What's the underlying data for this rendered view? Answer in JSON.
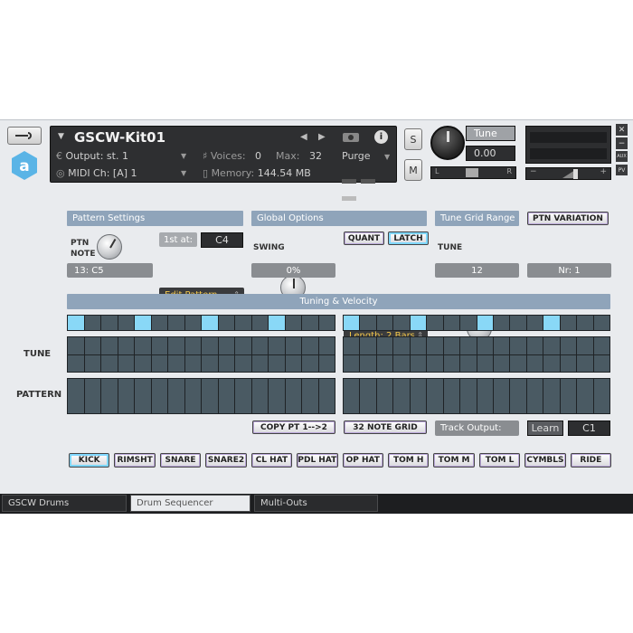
{
  "header": {
    "instrument_name": "GSCW-Kit01",
    "output_label": "Output:",
    "output_value": "st. 1",
    "midi_label": "MIDI Ch:",
    "midi_value": "[A] 1",
    "voices_label": "Voices:",
    "voices_value": "0",
    "max_label": "Max:",
    "max_value": "32",
    "memory_label": "Memory:",
    "memory_value": "144.54 MB",
    "purge_label": "Purge",
    "s_label": "S",
    "m_label": "M",
    "tune_label": "Tune",
    "tune_value": "0.00",
    "pan_left": "L",
    "pan_right": "R",
    "vol_minus": "−",
    "vol_plus": "+",
    "aux_label": "AUX",
    "pv_label": "PV"
  },
  "pattern_settings": {
    "title": "Pattern Settings",
    "ptn_note_label": "PTN\nNOTE",
    "first_at_label": "1st at:",
    "first_at_value": "C4",
    "note_value": "13: C5",
    "edit_pattern": "Edit Pattern..."
  },
  "global_options": {
    "title": "Global Options",
    "swing_label": "SWING",
    "swing_value": "0%",
    "quant": "QUANT",
    "latch": "LATCH",
    "length": "Length: 2 Bars"
  },
  "tune_grid": {
    "title": "Tune Grid Range",
    "tune_label": "TUNE",
    "tune_value": "12"
  },
  "ptn_variation": {
    "button": "PTN VARIATION",
    "value": "Nr: 1"
  },
  "tuning_velocity": {
    "title": "Tuning & Velocity",
    "tune_row_label": "TUNE",
    "pattern_row_label": "PATTERN",
    "steps_per_half": 16,
    "active_steps_left": [
      0,
      4,
      8,
      12
    ],
    "active_steps_right": [
      0,
      4,
      8,
      12
    ]
  },
  "bottom_controls": {
    "copy": "COPY PT 1-->2",
    "note_grid": "32 NOTE GRID",
    "track_output": "Track Output:",
    "learn": "Learn",
    "learn_value": "C1"
  },
  "drums": [
    "KICK",
    "RIMSHT",
    "SNARE",
    "SNARE2",
    "CL HAT",
    "PDL HAT",
    "OP HAT",
    "TOM H",
    "TOM M",
    "TOM L",
    "CYMBLS",
    "RIDE"
  ],
  "tabs": [
    "GSCW Drums",
    "Drum Sequencer",
    "Multi-Outs"
  ],
  "colors": {
    "accent_blue": "#89d8f7",
    "section_header": "#8fa4ba",
    "dropdown_text": "#f3c84c"
  }
}
